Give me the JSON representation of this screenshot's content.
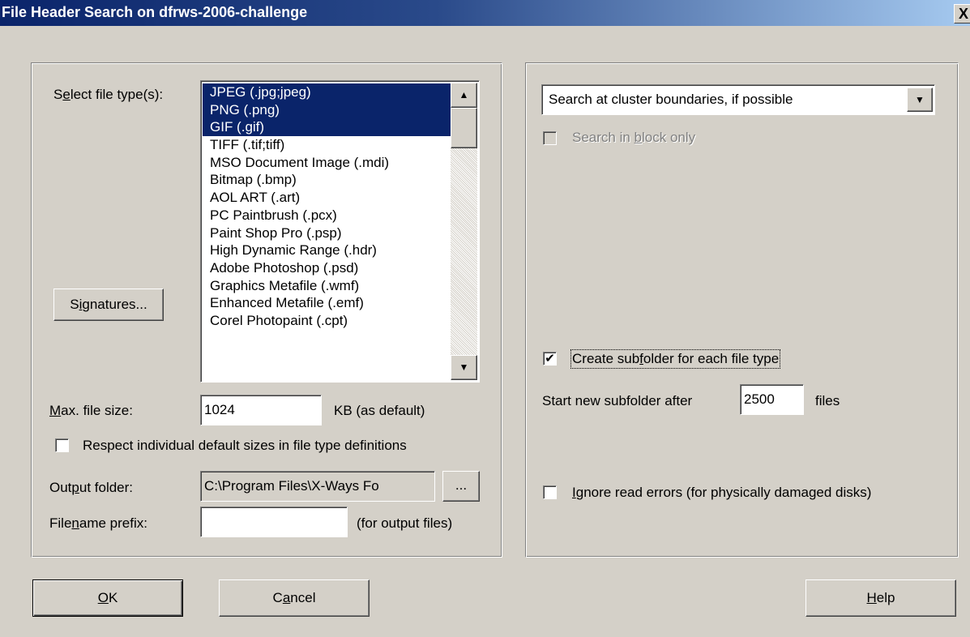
{
  "window": {
    "title": "File Header Search on dfrws-2006-challenge",
    "close_label": "X"
  },
  "left": {
    "select_label_pre": "S",
    "select_label_acc": "e",
    "select_label_post": "lect file type(s):",
    "file_types": [
      {
        "label": "JPEG (.jpg;jpeg)",
        "selected": true
      },
      {
        "label": "PNG (.png)",
        "selected": true
      },
      {
        "label": "GIF (.gif)",
        "selected": true
      },
      {
        "label": "TIFF (.tif;tiff)",
        "selected": false
      },
      {
        "label": "MSO Document Image (.mdi)",
        "selected": false
      },
      {
        "label": "Bitmap (.bmp)",
        "selected": false
      },
      {
        "label": "AOL ART (.art)",
        "selected": false
      },
      {
        "label": "PC Paintbrush (.pcx)",
        "selected": false
      },
      {
        "label": "Paint Shop Pro (.psp)",
        "selected": false
      },
      {
        "label": "High Dynamic Range (.hdr)",
        "selected": false
      },
      {
        "label": "Adobe Photoshop (.psd)",
        "selected": false
      },
      {
        "label": "Graphics Metafile (.wmf)",
        "selected": false
      },
      {
        "label": "Enhanced Metafile (.emf)",
        "selected": false
      },
      {
        "label": "Corel Photopaint (.cpt)",
        "selected": false
      }
    ],
    "signatures_pre": "S",
    "signatures_acc": "i",
    "signatures_post": "gnatures...",
    "max_size_acc": "M",
    "max_size_post": "ax. file size:",
    "max_size_value": "1024",
    "max_size_unit": "KB (as default)",
    "respect_label": "Respect individual default sizes in file type definitions",
    "respect_checked": false,
    "output_pre": "Out",
    "output_acc": "p",
    "output_post": "ut folder:",
    "output_value": "C:\\Program Files\\X-Ways Fo",
    "browse_label": "...",
    "prefix_pre": "File",
    "prefix_acc": "n",
    "prefix_post": "ame prefix:",
    "prefix_value": "",
    "prefix_note": "(for output files)"
  },
  "right": {
    "search_mode": "Search at cluster boundaries, if possible",
    "block_only_pre": "Search in ",
    "block_only_acc": "b",
    "block_only_post": "lock only",
    "block_only_checked": false,
    "subfolder_pre": "Create sub",
    "subfolder_acc": "f",
    "subfolder_post": "older for each file type",
    "subfolder_checked": true,
    "start_new_label": "Start new subfolder after",
    "start_new_value": "2500",
    "start_new_unit": "files",
    "ignore_acc": "I",
    "ignore_post": "gnore read errors (for physically damaged disks)",
    "ignore_checked": false
  },
  "buttons": {
    "ok_acc": "O",
    "ok_post": "K",
    "cancel_pre": "C",
    "cancel_acc": "a",
    "cancel_post": "ncel",
    "help_acc": "H",
    "help_post": "elp"
  }
}
